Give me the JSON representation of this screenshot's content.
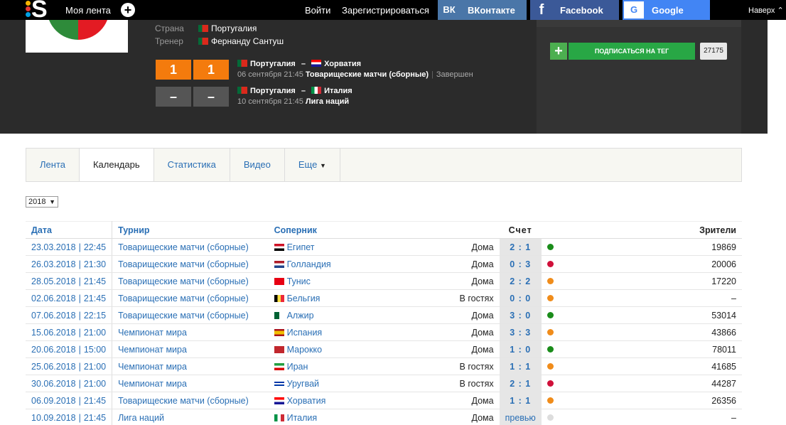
{
  "topbar": {
    "feed": "Моя лента",
    "plus": "+",
    "login": "Войти",
    "register": "Зарегистрироваться",
    "vk": "ВКонтакте",
    "vk_icon": "ВК",
    "facebook": "Facebook",
    "facebook_icon": "f",
    "google": "Google",
    "google_icon": "G",
    "up": "Наверх ⌃"
  },
  "team": {
    "country_label": "Страна",
    "country": "Португалия",
    "coach_label": "Тренер",
    "coach": "Фернанду Сантуш"
  },
  "matches": [
    {
      "home": "1",
      "away": "1",
      "team1": "Португалия",
      "dash": "–",
      "team2": "Хорватия",
      "date": "06 сентября 21:45",
      "tournament": "Товарищеские матчи (сборные)",
      "status": "Завершен"
    },
    {
      "home": "–",
      "away": "–",
      "team1": "Португалия",
      "dash": "–",
      "team2": "Италия",
      "date": "10 сентября 21:45",
      "tournament": "Лига наций",
      "status": ""
    }
  ],
  "subscribe": {
    "plus": "+",
    "label": "ПОДПИСАТЬСЯ НА ТЕГ",
    "count": "27175"
  },
  "tabs": [
    "Лента",
    "Календарь",
    "Статистика",
    "Видео",
    "Еще"
  ],
  "year": "2018",
  "table": {
    "headers": {
      "date": "Дата",
      "tournament": "Турнир",
      "opponent": "Соперник",
      "score": "Счет",
      "viewers": "Зрители"
    },
    "rows": [
      {
        "date": "23.03.2018",
        "time": "22:45",
        "tournament": "Товарищеские матчи (сборные)",
        "opponent": "Египет",
        "venue": "Дома",
        "score": "2 : 1",
        "result_color": "#1a8c1a",
        "viewers": "19869"
      },
      {
        "date": "26.03.2018",
        "time": "21:30",
        "tournament": "Товарищеские матчи (сборные)",
        "opponent": "Голландия",
        "venue": "Дома",
        "score": "0 : 3",
        "result_color": "#d0103a",
        "viewers": "20006"
      },
      {
        "date": "28.05.2018",
        "time": "21:45",
        "tournament": "Товарищеские матчи (сборные)",
        "opponent": "Тунис",
        "venue": "Дома",
        "score": "2 : 2",
        "result_color": "#f08c1a",
        "viewers": "17220"
      },
      {
        "date": "02.06.2018",
        "time": "21:45",
        "tournament": "Товарищеские матчи (сборные)",
        "opponent": "Бельгия",
        "venue": "В гостях",
        "score": "0 : 0",
        "result_color": "#f08c1a",
        "viewers": "–"
      },
      {
        "date": "07.06.2018",
        "time": "22:15",
        "tournament": "Товарищеские матчи (сборные)",
        "opponent": "Алжир",
        "venue": "Дома",
        "score": "3 : 0",
        "result_color": "#1a8c1a",
        "viewers": "53014"
      },
      {
        "date": "15.06.2018",
        "time": "21:00",
        "tournament": "Чемпионат мира",
        "opponent": "Испания",
        "venue": "Дома",
        "score": "3 : 3",
        "result_color": "#f08c1a",
        "viewers": "43866"
      },
      {
        "date": "20.06.2018",
        "time": "15:00",
        "tournament": "Чемпионат мира",
        "opponent": "Марокко",
        "venue": "Дома",
        "score": "1 : 0",
        "result_color": "#1a8c1a",
        "viewers": "78011"
      },
      {
        "date": "25.06.2018",
        "time": "21:00",
        "tournament": "Чемпионат мира",
        "opponent": "Иран",
        "venue": "В гостях",
        "score": "1 : 1",
        "result_color": "#f08c1a",
        "viewers": "41685"
      },
      {
        "date": "30.06.2018",
        "time": "21:00",
        "tournament": "Чемпионат мира",
        "opponent": "Уругвай",
        "venue": "В гостях",
        "score": "2 : 1",
        "result_color": "#d0103a",
        "viewers": "44287"
      },
      {
        "date": "06.09.2018",
        "time": "21:45",
        "tournament": "Товарищеские матчи (сборные)",
        "opponent": "Хорватия",
        "venue": "Дома",
        "score": "1 : 1",
        "result_color": "#f08c1a",
        "viewers": "26356"
      },
      {
        "date": "10.09.2018",
        "time": "21:45",
        "tournament": "Лига наций",
        "opponent": "Италия",
        "venue": "Дома",
        "score": "превью",
        "result_color": "#dddddd",
        "viewers": "–"
      }
    ]
  }
}
